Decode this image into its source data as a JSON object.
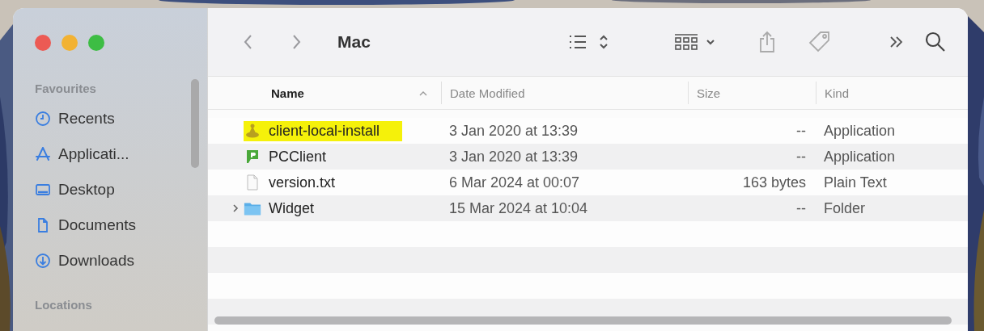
{
  "window": {
    "title": "Mac"
  },
  "sidebar": {
    "sections": [
      {
        "heading": "Favourites",
        "items": [
          {
            "label": "Recents"
          },
          {
            "label": "Applicati..."
          },
          {
            "label": "Desktop"
          },
          {
            "label": "Documents"
          },
          {
            "label": "Downloads"
          }
        ]
      },
      {
        "heading": "Locations"
      }
    ]
  },
  "table": {
    "columns": [
      {
        "label": "Name",
        "sorted": true
      },
      {
        "label": "Date Modified",
        "sorted": false
      },
      {
        "label": "Size",
        "sorted": false
      },
      {
        "label": "Kind",
        "sorted": false
      }
    ],
    "rows": [
      {
        "name": "client-local-install",
        "date": "3 Jan 2020 at 13:39",
        "size": "--",
        "kind": "Application",
        "highlighted": true,
        "expandable": false
      },
      {
        "name": "PCClient",
        "date": "3 Jan 2020 at 13:39",
        "size": "--",
        "kind": "Application",
        "highlighted": false,
        "expandable": false
      },
      {
        "name": "version.txt",
        "date": "6 Mar 2024 at 00:07",
        "size": "163 bytes",
        "kind": "Plain Text",
        "highlighted": false,
        "expandable": false
      },
      {
        "name": "Widget",
        "date": "15 Mar 2024 at 10:04",
        "size": "--",
        "kind": "Folder",
        "highlighted": false,
        "expandable": true
      }
    ]
  }
}
